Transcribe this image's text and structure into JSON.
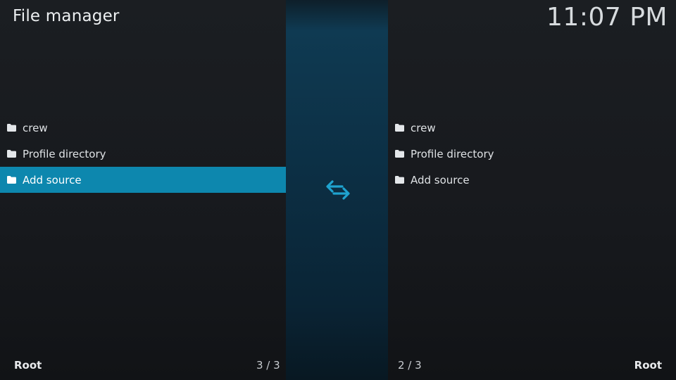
{
  "header": {
    "title": "File manager",
    "clock": "11:07 PM"
  },
  "left_pane": {
    "items": [
      {
        "label": "crew",
        "icon": "folder-icon"
      },
      {
        "label": "Profile directory",
        "icon": "folder-icon"
      },
      {
        "label": "Add source",
        "icon": "folder-icon"
      }
    ],
    "selected_index": 2,
    "footer_label": "Root",
    "count": "3 / 3"
  },
  "right_pane": {
    "items": [
      {
        "label": "crew",
        "icon": "folder-icon"
      },
      {
        "label": "Profile directory",
        "icon": "folder-icon"
      },
      {
        "label": "Add source",
        "icon": "folder-icon"
      }
    ],
    "footer_label": "Root",
    "count": "2 / 3"
  },
  "divider": {
    "icon": "swap-arrows-icon"
  },
  "colors": {
    "accent": "#0d87ae",
    "swap_icon": "#1fa3cf",
    "background": "#15181c"
  }
}
